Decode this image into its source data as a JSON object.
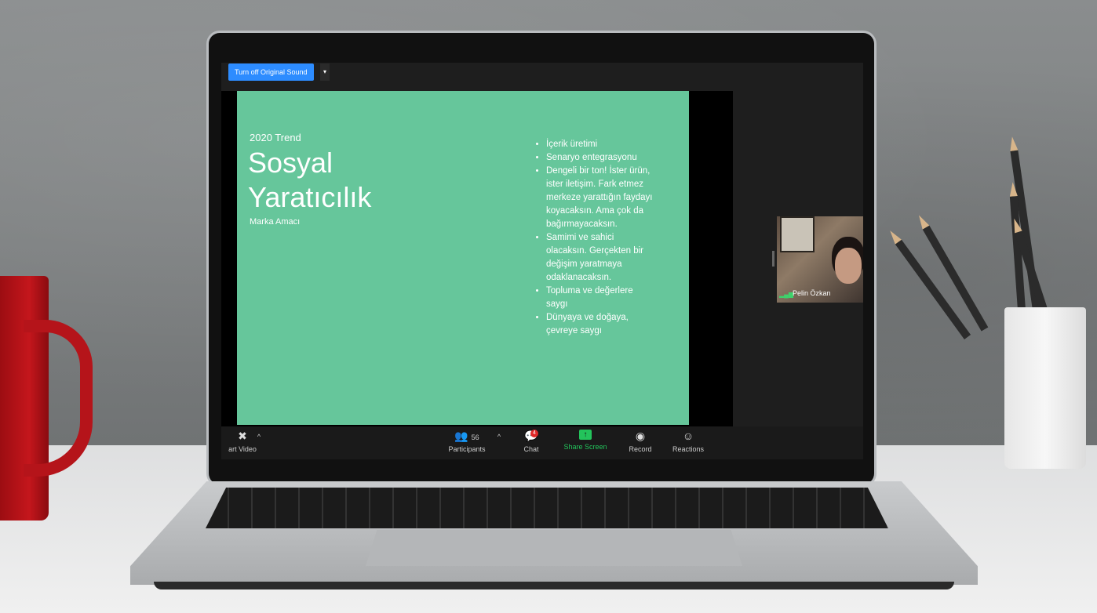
{
  "zoom": {
    "sound_button": "Turn off Original Sound",
    "sound_caret": "▾",
    "slide": {
      "kicker": "2020 Trend",
      "title": "Sosyal Yaratıcılık",
      "subtitle": "Marka Amacı",
      "bullets": [
        "İçerik üretimi",
        "Senaryo entegrasyonu",
        "Dengeli bir ton! İster ürün, ister iletişim. Fark etmez merkeze yarattığın faydayı koyacaksın. Ama çok da bağırmayacaksın.",
        "Samimi ve sahici olacaksın. Gerçekten bir değişim yaratmaya odaklanacaksın.",
        "Topluma ve değerlere saygı",
        "Dünyaya ve doğaya, çevreye saygı"
      ]
    },
    "participant": {
      "name": "Pelin Özkan",
      "signal": "▂▄▆"
    },
    "toolbar": {
      "video_label": "art Video",
      "video_caret": "^",
      "participants_label": "Participants",
      "participants_count": "56",
      "participants_caret": "^",
      "chat_label": "Chat",
      "chat_badge": "4",
      "share_label": "Share Screen",
      "record_label": "Record",
      "reactions_label": "Reactions"
    }
  },
  "colors": {
    "slide_bg": "#66c69b",
    "accent_blue": "#2d8cff",
    "accent_green": "#23c35b"
  },
  "icons": [
    "video-off-icon",
    "participants-icon",
    "chat-icon",
    "share-screen-icon",
    "record-icon",
    "reactions-icon",
    "signal-icon"
  ]
}
